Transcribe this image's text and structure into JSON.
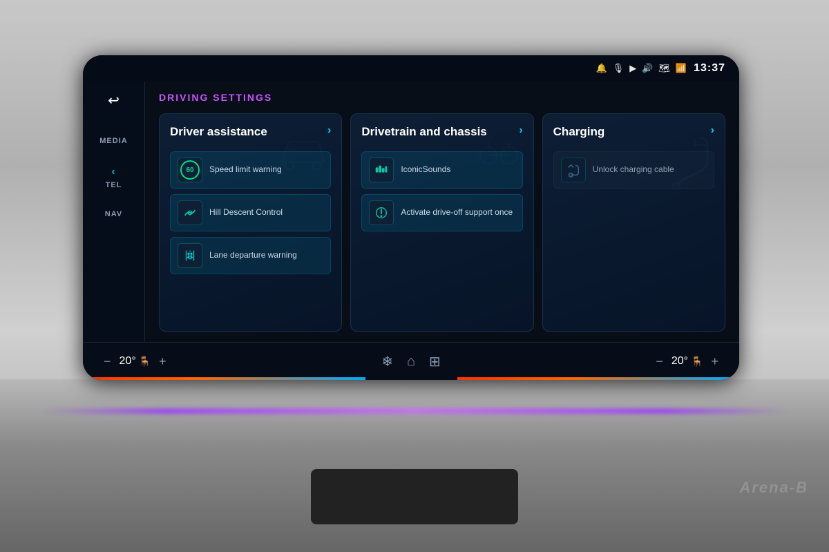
{
  "status_bar": {
    "time": "13:37",
    "icons": [
      "🔔",
      "🎤",
      "▶",
      "🔊",
      "📶",
      "📶"
    ]
  },
  "sidebar": {
    "back_label": "↩",
    "items": [
      {
        "id": "media",
        "label": "MEDIA"
      },
      {
        "id": "tel",
        "label": "TEL"
      },
      {
        "id": "nav",
        "label": "NAV"
      }
    ]
  },
  "page": {
    "title": "DRIVING SETTINGS"
  },
  "cards": [
    {
      "id": "driver-assistance",
      "title": "Driver assistance",
      "arrow": "›",
      "items": [
        {
          "id": "speed-limit",
          "label": "Speed limit warning",
          "icon_type": "speed",
          "icon_value": "60"
        },
        {
          "id": "hill-descent",
          "label": "Hill Descent Control",
          "icon_type": "svg"
        },
        {
          "id": "lane-departure",
          "label": "Lane departure warning",
          "icon_type": "svg"
        }
      ]
    },
    {
      "id": "drivetrain",
      "title": "Drivetrain and chassis",
      "arrow": "›",
      "items": [
        {
          "id": "iconic-sounds",
          "label": "IconicSounds",
          "icon_type": "svg"
        },
        {
          "id": "drive-off",
          "label": "Activate drive-off support once",
          "icon_type": "svg"
        }
      ]
    },
    {
      "id": "charging",
      "title": "Charging",
      "arrow": "›",
      "items": [
        {
          "id": "unlock-cable",
          "label": "Unlock charging cable",
          "icon_type": "svg",
          "disabled": true
        }
      ]
    }
  ],
  "bottom_bar": {
    "left_temp": "20°",
    "left_temp_icon": "🪑",
    "right_temp": "20°",
    "right_temp_icon": "🪑",
    "minus_label": "−",
    "plus_label": "+",
    "fan_icon": "❄",
    "home_icon": "⌂",
    "grid_icon": "⊞"
  },
  "watermark": "Arena-B"
}
